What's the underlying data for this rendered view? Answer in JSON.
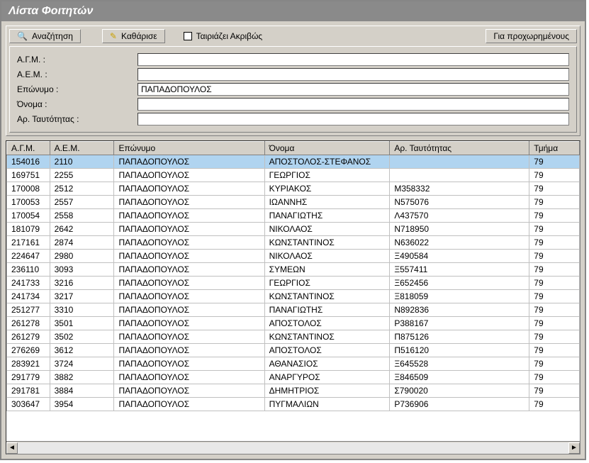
{
  "title": "Λίστα Φοιτητών",
  "buttons": {
    "search": "Αναζήτηση",
    "clear": "Καθάρισε",
    "advanced": "Για προχωρημένους"
  },
  "checkbox": {
    "exact": "Ταιριάζει Ακριβώς"
  },
  "filters": {
    "labels": {
      "agm": "Α.Γ.Μ. :",
      "aem": "Α.Ε.Μ. :",
      "eponimo": "Επώνυμο :",
      "onoma": "Όνομα :",
      "ar_taut": "Αρ. Ταυτότητας :"
    },
    "values": {
      "agm": "",
      "aem": "",
      "eponimo": "ΠΑΠΑΔΟΠΟΥΛΟΣ",
      "onoma": "",
      "ar_taut": ""
    }
  },
  "columns": {
    "agm": "Α.Γ.Μ.",
    "aem": "Α.Ε.Μ.",
    "eponimo": "Επώνυμο",
    "onoma": "Όνομα",
    "ar_taut": "Αρ. Ταυτότητας",
    "tmima": "Τμήμα"
  },
  "rows": [
    {
      "agm": "154016",
      "aem": "2110",
      "eponimo": "ΠΑΠΑΔΟΠΟΥΛΟΣ",
      "onoma": "ΑΠΟΣΤΟΛΟΣ-ΣΤΕΦΑΝΟΣ",
      "ar_taut": "",
      "tmima": "79",
      "selected": true
    },
    {
      "agm": "169751",
      "aem": "2255",
      "eponimo": "ΠΑΠΑΔΟΠΟΥΛΟΣ",
      "onoma": "ΓΕΩΡΓΙΟΣ",
      "ar_taut": "",
      "tmima": "79"
    },
    {
      "agm": "170008",
      "aem": "2512",
      "eponimo": "ΠΑΠΑΔΟΠΟΥΛΟΣ",
      "onoma": "ΚΥΡΙΑΚΟΣ",
      "ar_taut": "Μ358332",
      "tmima": "79"
    },
    {
      "agm": "170053",
      "aem": "2557",
      "eponimo": "ΠΑΠΑΔΟΠΟΥΛΟΣ",
      "onoma": "ΙΩΑΝΝΗΣ",
      "ar_taut": "Ν575076",
      "tmima": "79"
    },
    {
      "agm": "170054",
      "aem": "2558",
      "eponimo": "ΠΑΠΑΔΟΠΟΥΛΟΣ",
      "onoma": "ΠΑΝΑΓΙΩΤΗΣ",
      "ar_taut": "Λ437570",
      "tmima": "79"
    },
    {
      "agm": "181079",
      "aem": "2642",
      "eponimo": "ΠΑΠΑΔΟΠΟΥΛΟΣ",
      "onoma": "ΝΙΚΟΛΑΟΣ",
      "ar_taut": "Ν718950",
      "tmima": "79"
    },
    {
      "agm": "217161",
      "aem": "2874",
      "eponimo": "ΠΑΠΑΔΟΠΟΥΛΟΣ",
      "onoma": "ΚΩΝΣΤΑΝΤΙΝΟΣ",
      "ar_taut": "Ν636022",
      "tmima": "79"
    },
    {
      "agm": "224647",
      "aem": "2980",
      "eponimo": "ΠΑΠΑΔΟΠΟΥΛΟΣ",
      "onoma": "ΝΙΚΟΛΑΟΣ",
      "ar_taut": "Ξ490584",
      "tmima": "79"
    },
    {
      "agm": "236110",
      "aem": "3093",
      "eponimo": "ΠΑΠΑΔΟΠΟΥΛΟΣ",
      "onoma": "ΣΥΜΕΩΝ",
      "ar_taut": "Ξ557411",
      "tmima": "79"
    },
    {
      "agm": "241733",
      "aem": "3216",
      "eponimo": "ΠΑΠΑΔΟΠΟΥΛΟΣ",
      "onoma": "ΓΕΩΡΓΙΟΣ",
      "ar_taut": "Ξ652456",
      "tmima": "79"
    },
    {
      "agm": "241734",
      "aem": "3217",
      "eponimo": "ΠΑΠΑΔΟΠΟΥΛΟΣ",
      "onoma": "ΚΩΝΣΤΑΝΤΙΝΟΣ",
      "ar_taut": "Ξ818059",
      "tmima": "79"
    },
    {
      "agm": "251277",
      "aem": "3310",
      "eponimo": "ΠΑΠΑΔΟΠΟΥΛΟΣ",
      "onoma": "ΠΑΝΑΓΙΩΤΗΣ",
      "ar_taut": "Ν892836",
      "tmima": "79"
    },
    {
      "agm": "261278",
      "aem": "3501",
      "eponimo": "ΠΑΠΑΔΟΠΟΥΛΟΣ",
      "onoma": "ΑΠΟΣΤΟΛΟΣ",
      "ar_taut": "Ρ388167",
      "tmima": "79"
    },
    {
      "agm": "261279",
      "aem": "3502",
      "eponimo": "ΠΑΠΑΔΟΠΟΥΛΟΣ",
      "onoma": "ΚΩΝΣΤΑΝΤΙΝΟΣ",
      "ar_taut": "Π875126",
      "tmima": "79"
    },
    {
      "agm": "276269",
      "aem": "3612",
      "eponimo": "ΠΑΠΑΔΟΠΟΥΛΟΣ",
      "onoma": "ΑΠΟΣΤΟΛΟΣ",
      "ar_taut": "Π516120",
      "tmima": "79"
    },
    {
      "agm": "283921",
      "aem": "3724",
      "eponimo": "ΠΑΠΑΔΟΠΟΥΛΟΣ",
      "onoma": "ΑΘΑΝΑΣΙΟΣ",
      "ar_taut": "Ξ645528",
      "tmima": "79"
    },
    {
      "agm": "291779",
      "aem": "3882",
      "eponimo": "ΠΑΠΑΔΟΠΟΥΛΟΣ",
      "onoma": "ΑΝΑΡΓΥΡΟΣ",
      "ar_taut": "Ξ846509",
      "tmima": "79"
    },
    {
      "agm": "291781",
      "aem": "3884",
      "eponimo": "ΠΑΠΑΔΟΠΟΥΛΟΣ",
      "onoma": "ΔΗΜΗΤΡΙΟΣ",
      "ar_taut": "Σ790020",
      "tmima": "79"
    },
    {
      "agm": "303647",
      "aem": "3954",
      "eponimo": "ΠΑΠΑΔΟΠΟΥΛΟΣ",
      "onoma": "ΠΥΓΜΑΛΙΩΝ",
      "ar_taut": "Ρ736906",
      "tmima": "79"
    }
  ]
}
